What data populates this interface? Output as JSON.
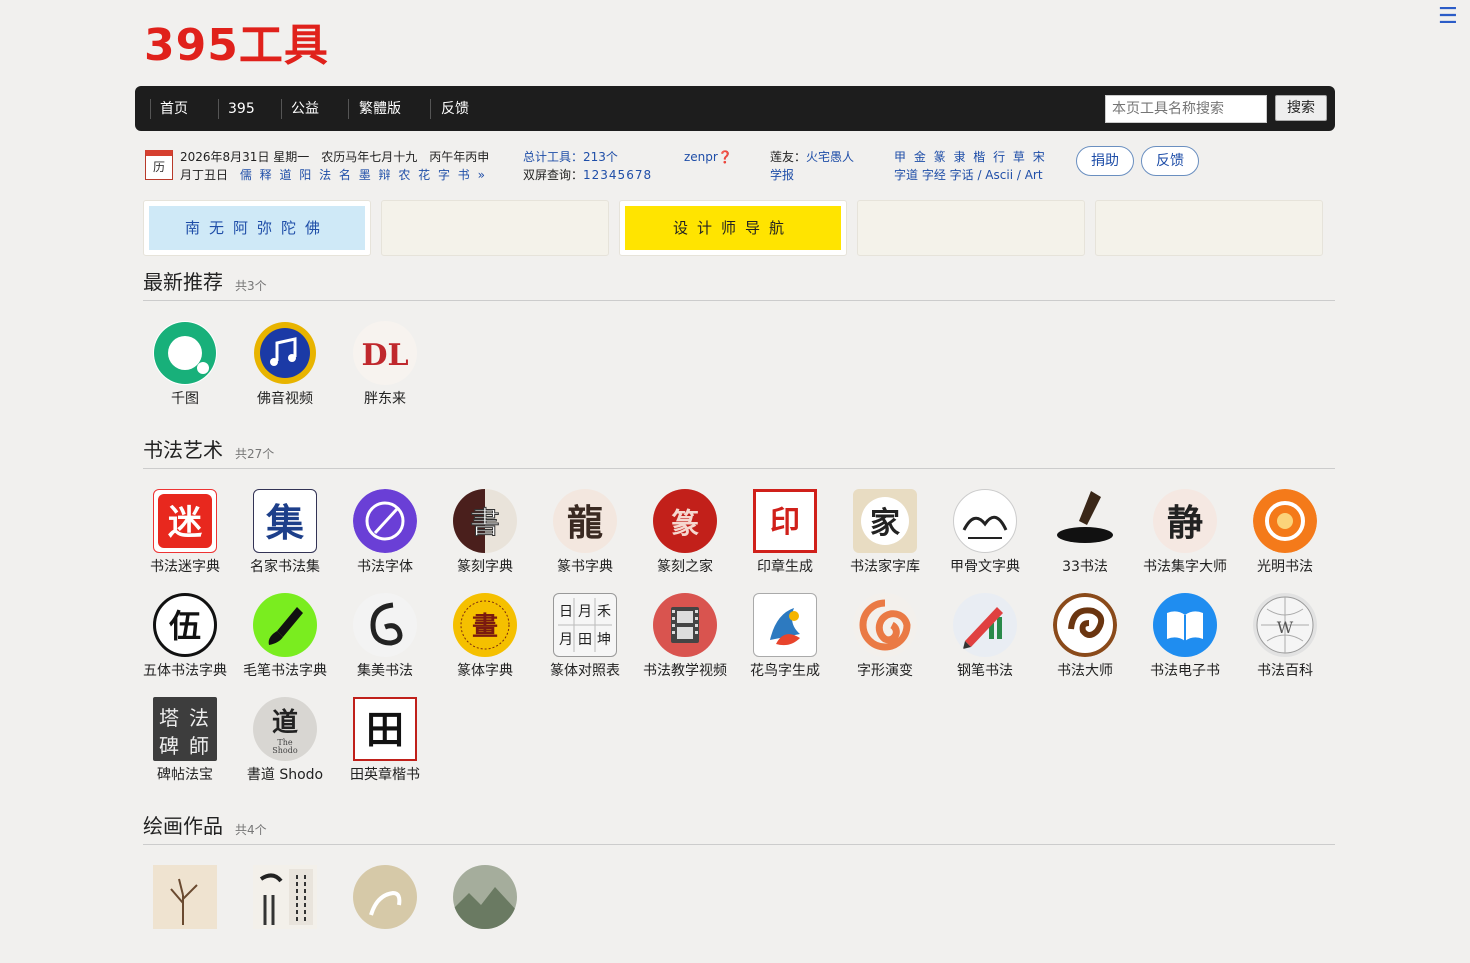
{
  "header": {
    "logo": "395工具",
    "menu_icon": "☰",
    "nav": [
      "首页",
      "395",
      "公益",
      "繁體版",
      "反馈"
    ],
    "search_placeholder": "本页工具名称搜索",
    "search_button": "搜索"
  },
  "info": {
    "calendar_icon": "历",
    "date_line1": "2026年8月31日 星期一　农历马年七月十九　丙午年丙申",
    "date_line2_prefix": "月丁丑日",
    "date_links": "儒 释 道 阳 法 名 墨 辩 农 花 字 书 »",
    "total_label": "总计工具：213个",
    "user": "zenpr❓",
    "dual_label": "双屏查询：",
    "dual_value": "12345678",
    "friend_label": "莲友：",
    "friend_value": "火宅愚人",
    "friend_line2": "学报",
    "scripts": "甲 金 篆 隶 楷 行 草 宋",
    "script_links": "字道  字经  字话 / Ascii / Art",
    "donate": "捐助",
    "feedback": "反馈"
  },
  "banners": [
    "南无阿弥陀佛",
    "",
    "设计师导航",
    "",
    ""
  ],
  "sections": [
    {
      "title": "最新推荐",
      "count": "共3个",
      "items": [
        {
          "label": "千图",
          "icon": "qiantu-icon"
        },
        {
          "label": "佛音视频",
          "icon": "music-note-icon"
        },
        {
          "label": "胖东来",
          "icon": "dl-logo-icon"
        }
      ]
    },
    {
      "title": "书法艺术",
      "count": "共27个",
      "items": [
        {
          "label": "书法迷字典",
          "icon": "mi-char-icon"
        },
        {
          "label": "名家书法集",
          "icon": "ji-char-icon"
        },
        {
          "label": "书法字体",
          "icon": "brush-pen-icon"
        },
        {
          "label": "篆刻字典",
          "icon": "seal-script-icon"
        },
        {
          "label": "篆书字典",
          "icon": "seal-char-icon"
        },
        {
          "label": "篆刻之家",
          "icon": "red-seal-icon"
        },
        {
          "label": "印章生成",
          "icon": "stamp-icon"
        },
        {
          "label": "书法家字库",
          "icon": "jia-char-icon"
        },
        {
          "label": "甲骨文字典",
          "icon": "oracle-bone-icon"
        },
        {
          "label": "33书法",
          "icon": "brush-stroke-icon"
        },
        {
          "label": "书法集字大师",
          "icon": "jing-char-icon"
        },
        {
          "label": "光明书法",
          "icon": "orange-swirl-icon"
        },
        {
          "label": "五体书法字典",
          "icon": "wu-char-icon"
        },
        {
          "label": "毛笔书法字典",
          "icon": "green-brush-icon"
        },
        {
          "label": "集美书法",
          "icon": "dragon-icon"
        },
        {
          "label": "篆体字典",
          "icon": "yellow-seal-icon"
        },
        {
          "label": "篆体对照表",
          "icon": "char-table-icon"
        },
        {
          "label": "书法教学视频",
          "icon": "film-icon"
        },
        {
          "label": "花鸟字生成",
          "icon": "flower-bird-icon"
        },
        {
          "label": "字形演变",
          "icon": "spiral-icon"
        },
        {
          "label": "钢笔书法",
          "icon": "pen-chart-icon"
        },
        {
          "label": "书法大师",
          "icon": "brown-swirl-icon"
        },
        {
          "label": "书法电子书",
          "icon": "book-icon"
        },
        {
          "label": "书法百科",
          "icon": "wiki-globe-icon"
        },
        {
          "label": "碑帖法宝",
          "icon": "stele-icon"
        },
        {
          "label": "書道 Shodo",
          "icon": "shodo-icon"
        },
        {
          "label": "田英章楷书",
          "icon": "tian-char-icon"
        }
      ]
    },
    {
      "title": "绘画作品",
      "count": "共4个",
      "items": [
        {
          "label": "",
          "icon": "painting-tree-icon"
        },
        {
          "label": "",
          "icon": "painting-calligraphy-icon"
        },
        {
          "label": "",
          "icon": "painting-horse-icon"
        },
        {
          "label": "",
          "icon": "painting-landscape-icon"
        }
      ]
    }
  ]
}
